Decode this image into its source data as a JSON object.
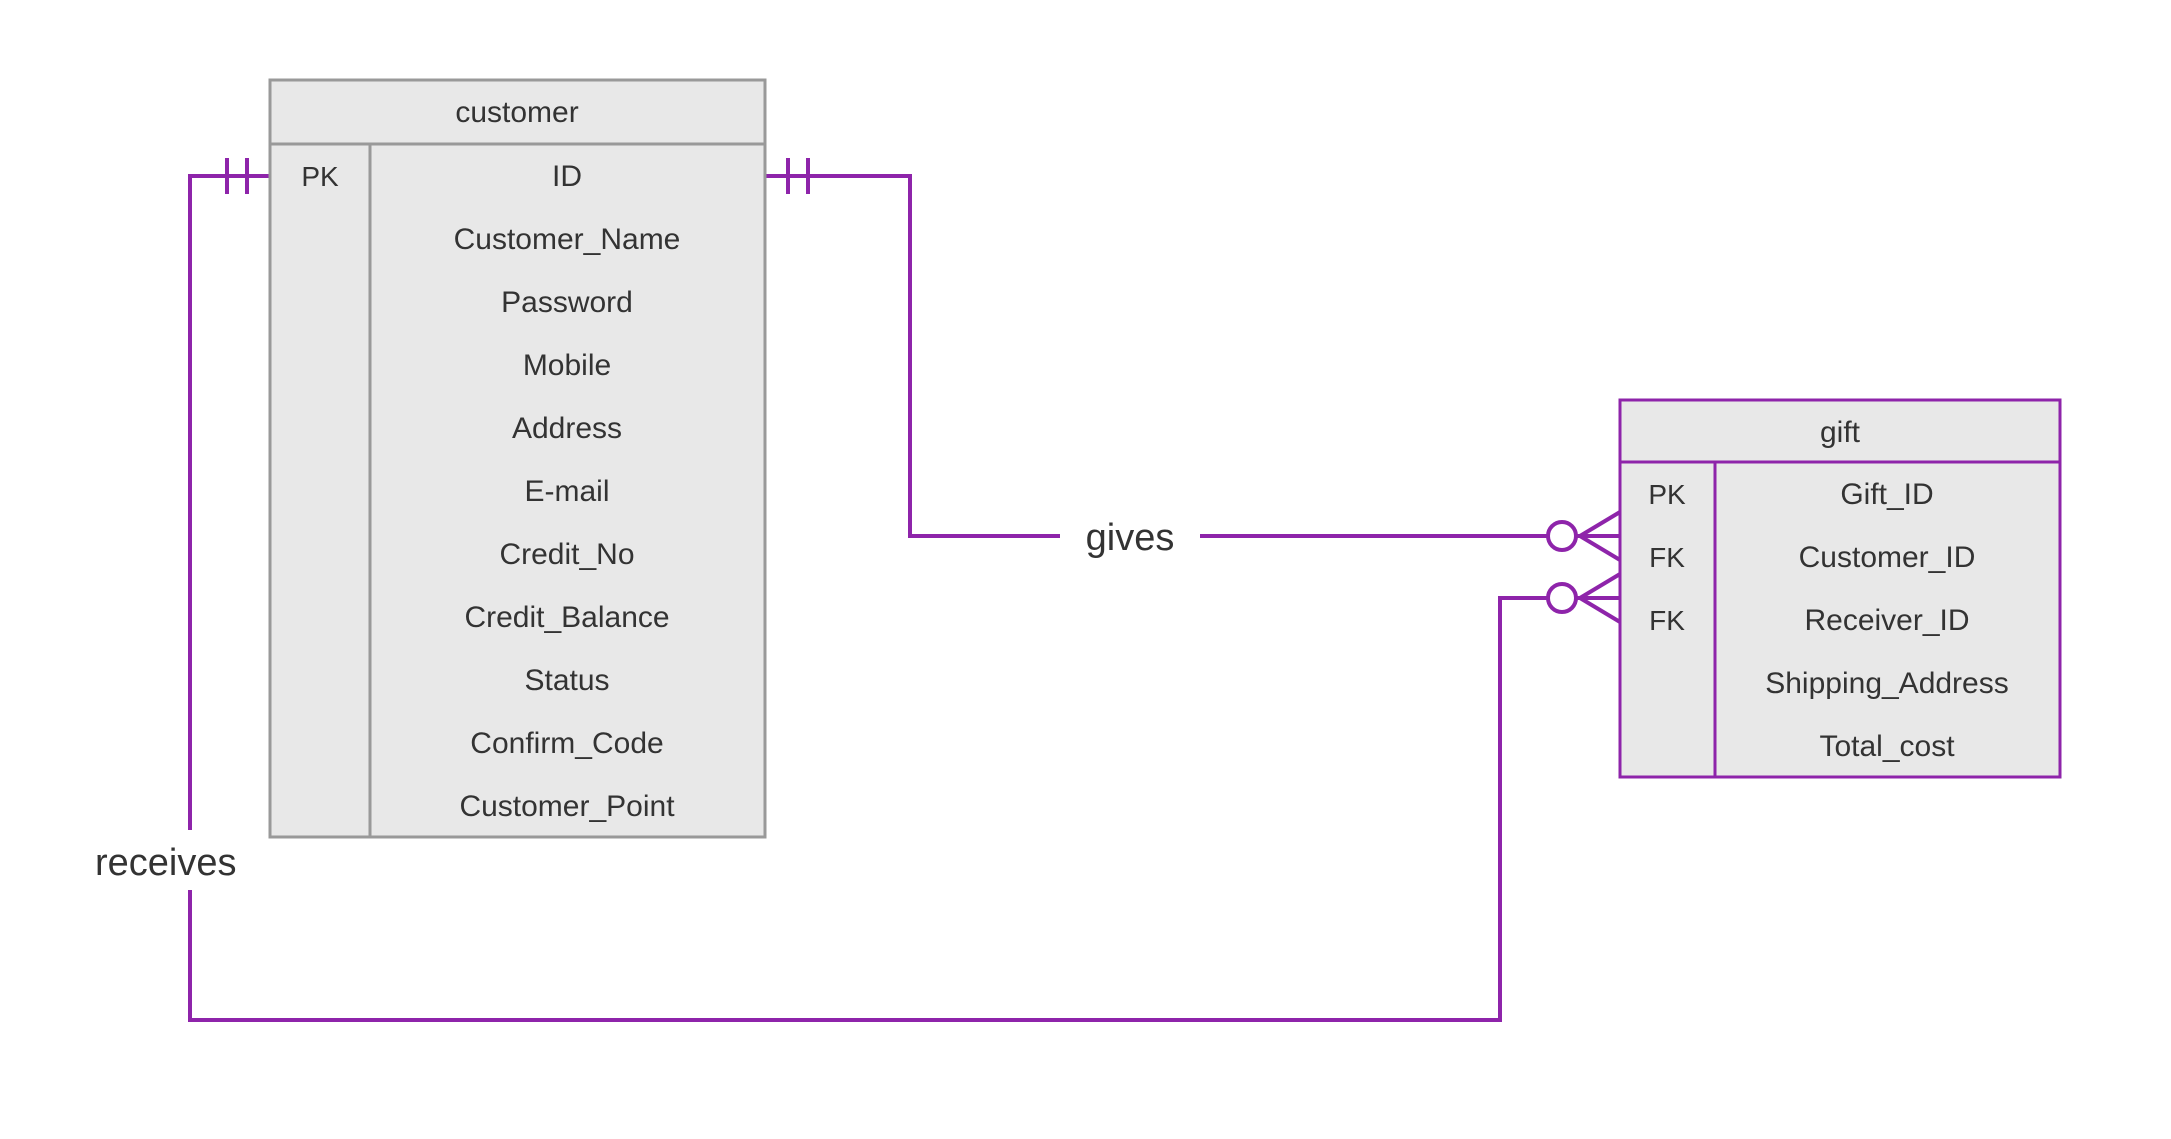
{
  "entities": {
    "customer": {
      "title": "customer",
      "stroke": "#999999",
      "rows": [
        {
          "key": "PK",
          "attr": "ID"
        },
        {
          "key": "",
          "attr": "Customer_Name"
        },
        {
          "key": "",
          "attr": "Password"
        },
        {
          "key": "",
          "attr": "Mobile"
        },
        {
          "key": "",
          "attr": "Address"
        },
        {
          "key": "",
          "attr": "E-mail"
        },
        {
          "key": "",
          "attr": "Credit_No"
        },
        {
          "key": "",
          "attr": "Credit_Balance"
        },
        {
          "key": "",
          "attr": "Status"
        },
        {
          "key": "",
          "attr": "Confirm_Code"
        },
        {
          "key": "",
          "attr": "Customer_Point"
        }
      ]
    },
    "gift": {
      "title": "gift",
      "stroke": "#8e24aa",
      "rows": [
        {
          "key": "PK",
          "attr": "Gift_ID"
        },
        {
          "key": "FK",
          "attr": "Customer_ID"
        },
        {
          "key": "FK",
          "attr": "Receiver_ID"
        },
        {
          "key": "",
          "attr": "Shipping_Address"
        },
        {
          "key": "",
          "attr": "Total_cost"
        }
      ]
    }
  },
  "relationships": {
    "gives": "gives",
    "receives": "receives"
  },
  "chart_data": {
    "type": "er-diagram",
    "entities": [
      {
        "name": "customer",
        "attributes": [
          {
            "name": "ID",
            "key": "PK"
          },
          {
            "name": "Customer_Name"
          },
          {
            "name": "Password"
          },
          {
            "name": "Mobile"
          },
          {
            "name": "Address"
          },
          {
            "name": "E-mail"
          },
          {
            "name": "Credit_No"
          },
          {
            "name": "Credit_Balance"
          },
          {
            "name": "Status"
          },
          {
            "name": "Confirm_Code"
          },
          {
            "name": "Customer_Point"
          }
        ]
      },
      {
        "name": "gift",
        "attributes": [
          {
            "name": "Gift_ID",
            "key": "PK"
          },
          {
            "name": "Customer_ID",
            "key": "FK"
          },
          {
            "name": "Receiver_ID",
            "key": "FK"
          },
          {
            "name": "Shipping_Address"
          },
          {
            "name": "Total_cost"
          }
        ]
      }
    ],
    "relationships": [
      {
        "name": "gives",
        "from": {
          "entity": "customer",
          "cardinality": "exactly-one"
        },
        "to": {
          "entity": "gift",
          "cardinality": "zero-or-many",
          "via": "Customer_ID"
        }
      },
      {
        "name": "receives",
        "from": {
          "entity": "customer",
          "cardinality": "exactly-one"
        },
        "to": {
          "entity": "gift",
          "cardinality": "zero-or-many",
          "via": "Receiver_ID"
        }
      }
    ]
  }
}
